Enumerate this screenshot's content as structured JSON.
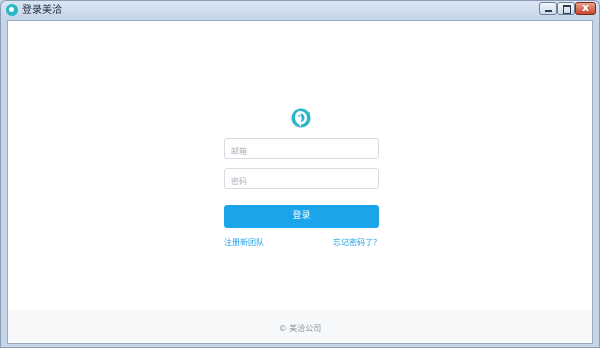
{
  "window": {
    "title": "登录美洽",
    "close_glyph": "x"
  },
  "login": {
    "logo_icon": "bird-chat-logo-icon",
    "email_placeholder": "邮箱",
    "password_placeholder": "密码",
    "login_label": "登录",
    "register_link": "注册新团队",
    "forgot_link": "忘记密码了？"
  },
  "footer": {
    "copyright": "© 美洽公司"
  },
  "colors": {
    "accent": "#1aa4ea",
    "link": "#1aa0e4",
    "logo": "#2cb5c9"
  }
}
